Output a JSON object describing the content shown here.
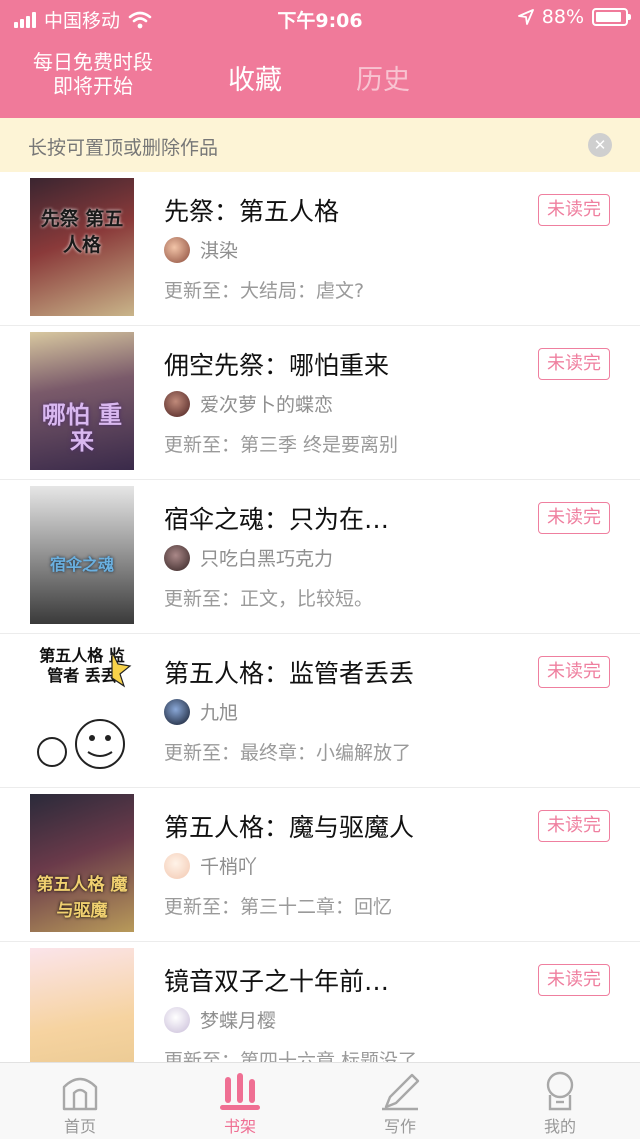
{
  "status_bar": {
    "carrier": "中国移动",
    "time": "下午9:06",
    "battery_percent": "88%",
    "battery_level": 0.88,
    "icons": [
      "signal-icon",
      "wifi-icon",
      "location-arrow-icon",
      "battery-icon"
    ]
  },
  "nav": {
    "promo_line1": "每日免费时段",
    "promo_line2": "即将开始",
    "tabs": [
      {
        "label": "收藏",
        "active": true
      },
      {
        "label": "历史",
        "active": false
      }
    ]
  },
  "notice": {
    "text": "长按可置顶或删除作品",
    "close_icon": "close-icon"
  },
  "books": [
    {
      "title": "先祭：第五人格",
      "badge": "未读完",
      "author": "淇染",
      "update": "更新至：大结局：虐文?",
      "cover_text": "先祭 第五人格"
    },
    {
      "title": "佣空先祭：哪怕重来",
      "badge": "未读完",
      "author": "爱次萝卜的蝶恋",
      "update": "更新至：第三季 终是要离别",
      "cover_text": "哪怕 重来"
    },
    {
      "title": "宿伞之魂：只为在…",
      "badge": "未读完",
      "author": "只吃白黑巧克力",
      "update": "更新至：正文，比较短。",
      "cover_text": "宿伞之魂"
    },
    {
      "title": "第五人格：监管者丢丢",
      "badge": "未读完",
      "author": "九旭",
      "update": "更新至：最终章：小编解放了",
      "cover_text": "第五人格 监管者 丢丢"
    },
    {
      "title": "第五人格：魔与驱魔人",
      "badge": "未读完",
      "author": "千梢吖",
      "update": "更新至：第三十二章：回忆",
      "cover_text": "第五人格 魔与驱魔"
    },
    {
      "title": "镜音双子之十年前…",
      "badge": "未读完",
      "author": "梦蝶月樱",
      "update": "更新至：第四十六章 标题没了",
      "cover_text": ""
    }
  ],
  "tabbar": {
    "items": [
      {
        "label": "首页",
        "icon": "home-icon",
        "active": false
      },
      {
        "label": "书架",
        "icon": "bookshelf-icon",
        "active": true
      },
      {
        "label": "写作",
        "icon": "pencil-icon",
        "active": false
      },
      {
        "label": "我的",
        "icon": "profile-icon",
        "active": false
      }
    ]
  },
  "colors": {
    "brand_pink": "#f07a9a",
    "notice_bg": "#fdf4d6",
    "badge_pink": "#ef7f9f",
    "tab_active": "#ef6f93"
  }
}
